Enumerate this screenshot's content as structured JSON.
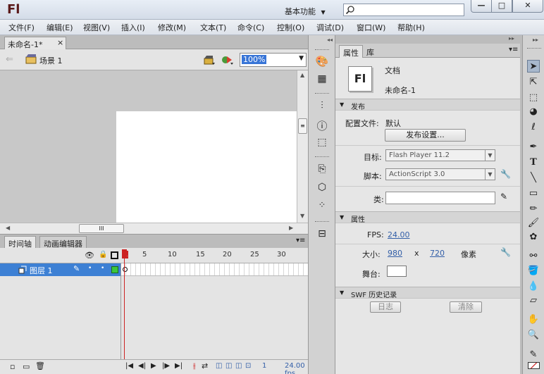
{
  "app": {
    "logo": "Fl",
    "workspace": "基本功能",
    "search_placeholder": ""
  },
  "window_buttons": {
    "minimize": "—",
    "maximize": "□",
    "close": "✕"
  },
  "menu": [
    "文件(F)",
    "编辑(E)",
    "视图(V)",
    "插入(I)",
    "修改(M)",
    "文本(T)",
    "命令(C)",
    "控制(O)",
    "调试(D)",
    "窗口(W)",
    "帮助(H)"
  ],
  "document_tab": {
    "title": "未命名-1*",
    "close": "×"
  },
  "edit_bar": {
    "scene": "场景 1",
    "zoom": "100%"
  },
  "timeline": {
    "tabs": [
      "时间轴",
      "动画编辑器"
    ],
    "frame_numbers": [
      "1",
      "5",
      "10",
      "15",
      "20",
      "25",
      "30"
    ],
    "layer_name": "图层 1",
    "current_frame": "1",
    "fps_readout": "24.00 fps"
  },
  "properties": {
    "tabs": [
      "属性",
      "库"
    ],
    "doc_icon": "Fl",
    "doc_type": "文档",
    "doc_name": "未命名-1",
    "publish": {
      "section": "发布",
      "profile_label": "配置文件:",
      "profile_value": "默认",
      "settings_button": "发布设置...",
      "target_label": "目标:",
      "target_value": "Flash Player 11.2",
      "script_label": "脚本:",
      "script_value": "ActionScript 3.0",
      "class_label": "类:",
      "class_value": ""
    },
    "attributes": {
      "section": "属性",
      "fps_label": "FPS:",
      "fps_value": "24.00",
      "size_label": "大小:",
      "width": "980",
      "x_sep": "x",
      "height": "720",
      "unit": "像素",
      "stage_label": "舞台:",
      "stage_color": "#FFFFFF"
    },
    "swf_history": {
      "section": "SWF 历史记录",
      "log_button": "日志",
      "clear_button": "清除"
    }
  },
  "colors": {
    "accent": "#3d80d4",
    "playhead": "#cc2222",
    "link": "#335fa8"
  }
}
